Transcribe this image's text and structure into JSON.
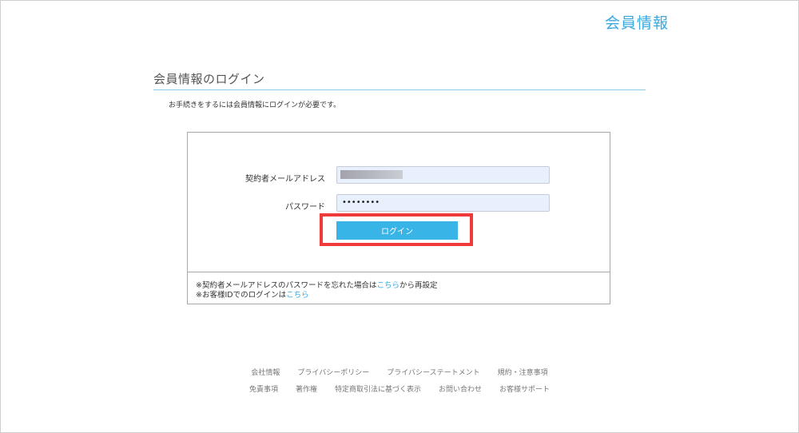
{
  "header": {
    "title": "会員情報"
  },
  "section": {
    "title": "会員情報のログイン",
    "intro": "お手続きをするには会員情報にログインが必要です。"
  },
  "form": {
    "email_label": "契約者メールアドレス",
    "email_value_state": "blurred",
    "password_label": "パスワード",
    "password_value": "••••••••",
    "login_button": "ログイン"
  },
  "notes": {
    "forgot_prefix": "※契約者メールアドレスのパスワードを忘れた場合は",
    "forgot_link": "こちら",
    "forgot_suffix": "から再設定",
    "customer_id_prefix": "※お客様IDでのログインは",
    "customer_id_link": "こちら"
  },
  "footer": {
    "row1": [
      "会社情報",
      "プライバシーポリシー",
      "プライバシーステートメント",
      "規約・注意事項"
    ],
    "row2": [
      "免責事項",
      "著作権",
      "特定商取引法に基づく表示",
      "お問い合わせ",
      "お客様サポート"
    ]
  },
  "colors": {
    "accent": "#38a8df",
    "button": "#38b4e6",
    "highlight": "#f03a3a",
    "input_bg": "#e8f0fe"
  }
}
